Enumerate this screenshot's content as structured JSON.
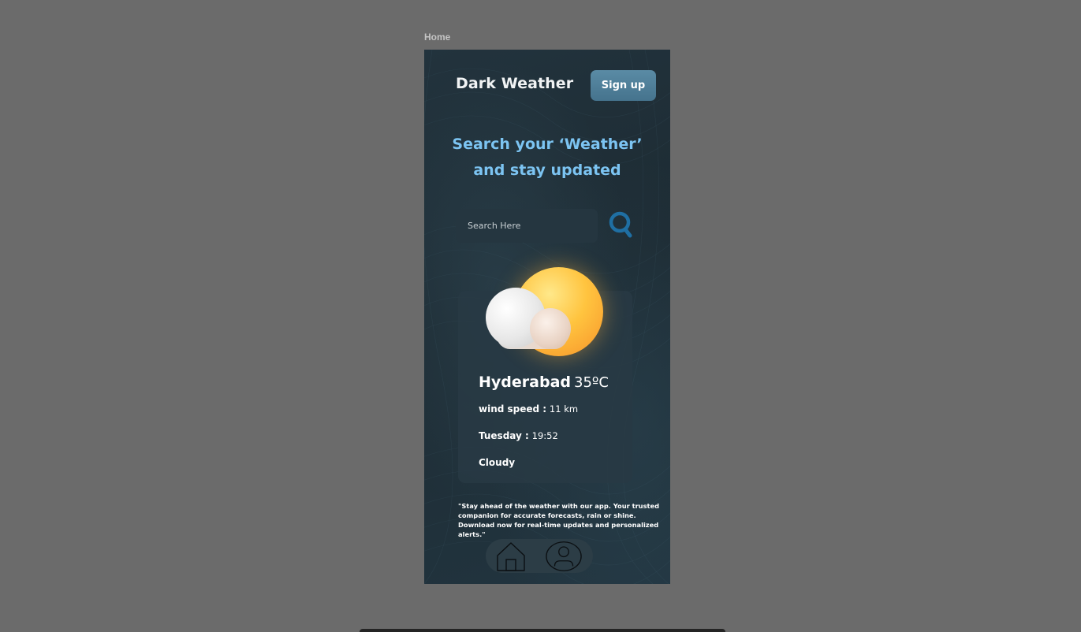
{
  "frame": {
    "label": "Home"
  },
  "header": {
    "title": "Dark Weather",
    "signup_label": "Sign up"
  },
  "hero": {
    "line1": "Search your ‘Weather’",
    "line2": "and stay updated"
  },
  "search": {
    "placeholder": "Search Here",
    "icon": "search-icon"
  },
  "weather": {
    "icon": "partly-cloudy-icon",
    "city": "Hyderabad",
    "temperature": "35ºC",
    "wind_label": "wind speed :",
    "wind_value": "11 km",
    "day_label": "Tuesday :",
    "time_value": "19:52",
    "condition": "Cloudy"
  },
  "quote": "\"Stay ahead of the weather with our app. Your trusted companion for accurate forecasts, rain or shine. Download now for real-time updates and personalized alerts.\"",
  "nav": {
    "items": [
      {
        "icon": "home-icon"
      },
      {
        "icon": "profile-icon"
      }
    ]
  },
  "colors": {
    "background": "#6b6b6b",
    "phone_bg": "#1f2e36",
    "accent": "#7cc4f2",
    "button": "#4f7f99",
    "search_icon": "#1f6fa3"
  }
}
